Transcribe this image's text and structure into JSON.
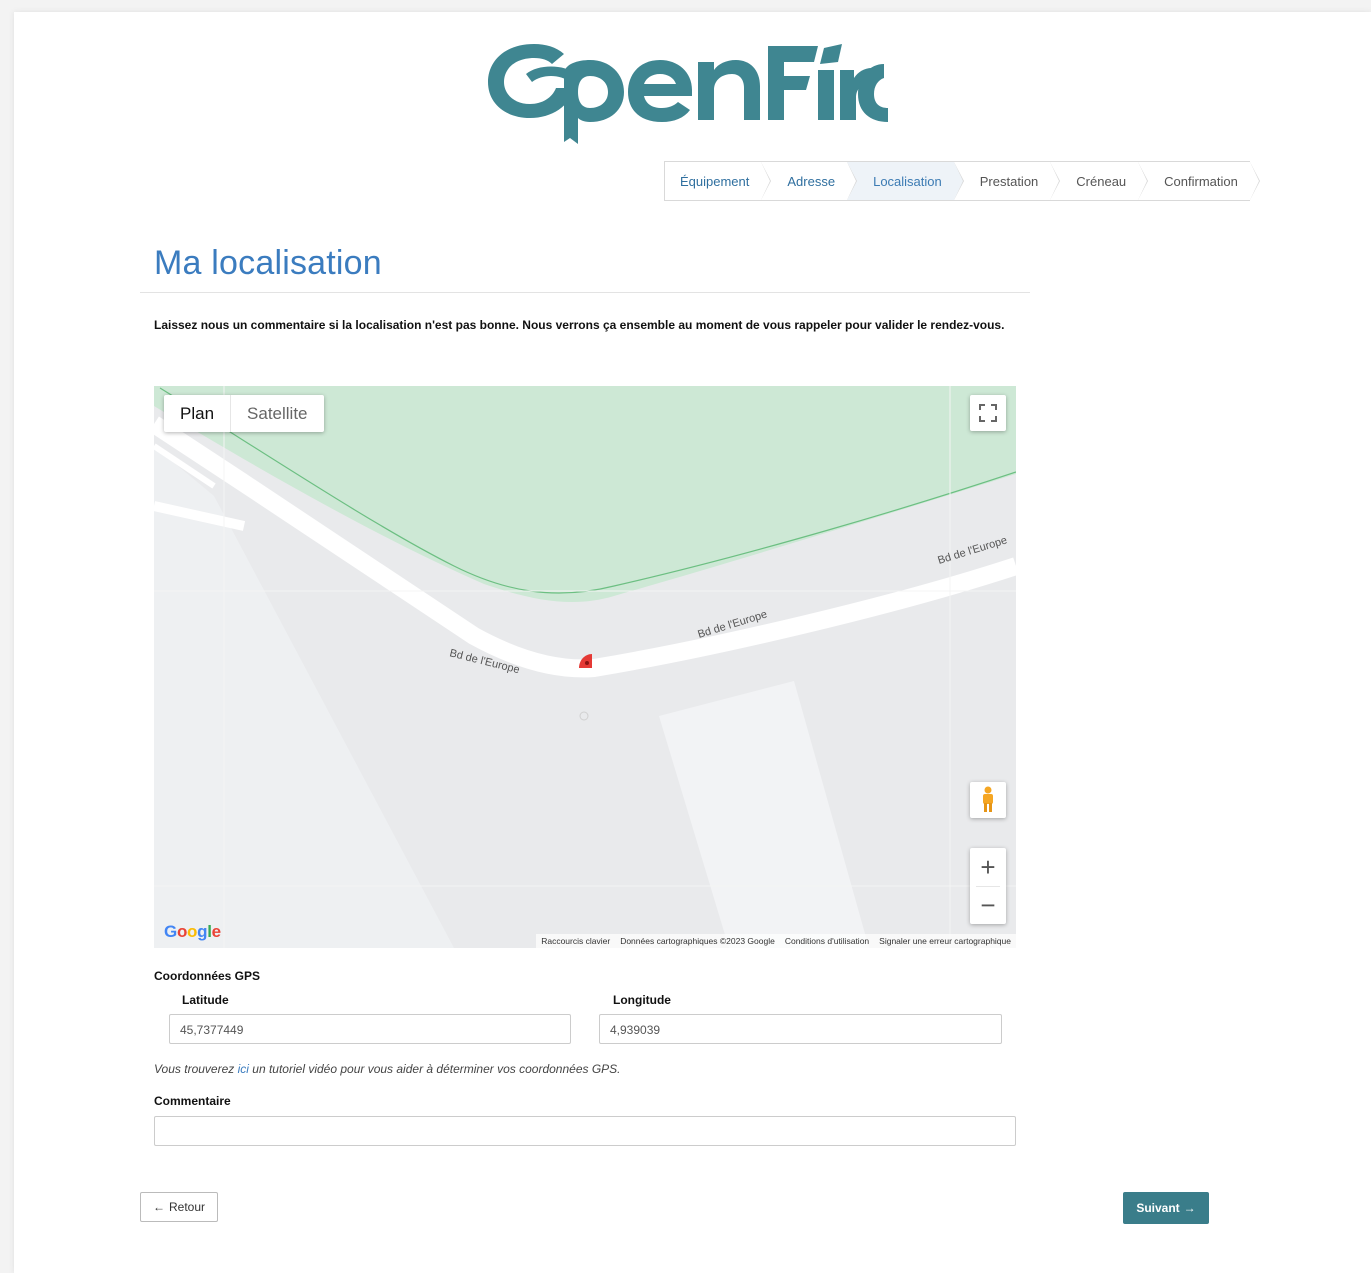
{
  "brand": {
    "name": "OpenFire",
    "color": "#3f8691"
  },
  "steps": [
    {
      "label": "Équipement",
      "state": "done"
    },
    {
      "label": "Adresse",
      "state": "done"
    },
    {
      "label": "Localisation",
      "state": "active"
    },
    {
      "label": "Prestation",
      "state": "todo"
    },
    {
      "label": "Créneau",
      "state": "todo"
    },
    {
      "label": "Confirmation",
      "state": "todo"
    }
  ],
  "page": {
    "title": "Ma localisation",
    "intro": "Laissez nous un commentaire si la localisation n'est pas bonne. Nous verrons ça ensemble au moment de vous rappeler pour valider le rendez-vous."
  },
  "map": {
    "type_plan": "Plan",
    "type_satellite": "Satellite",
    "street_1": "Bd de l'Europe",
    "street_2": "Bd de l'Europe",
    "street_3": "Bd de l'Europe",
    "google_logo": "Google",
    "attribution": {
      "shortcuts": "Raccourcis clavier",
      "data": "Données cartographiques ©2023 Google",
      "terms": "Conditions d'utilisation",
      "report": "Signaler une erreur cartographique"
    },
    "icons": [
      "fullscreen-icon",
      "pegman-icon",
      "zoom-in-icon",
      "zoom-out-icon",
      "map-marker-icon"
    ]
  },
  "gps": {
    "section_label": "Coordonnées GPS",
    "latitude_label": "Latitude",
    "latitude_value": "45,7377449",
    "longitude_label": "Longitude",
    "longitude_value": "4,939039"
  },
  "help": {
    "before": "Vous trouverez ",
    "link": "ici",
    "after": " un tutoriel vidéo pour vous aider à déterminer vos coordonnées GPS."
  },
  "comment": {
    "label": "Commentaire",
    "value": ""
  },
  "nav": {
    "back_label": "Retour",
    "next_label": "Suivant"
  },
  "colors": {
    "title": "#3b7cbf",
    "next_button": "#3a7d8a",
    "park": "#cde8d5"
  }
}
